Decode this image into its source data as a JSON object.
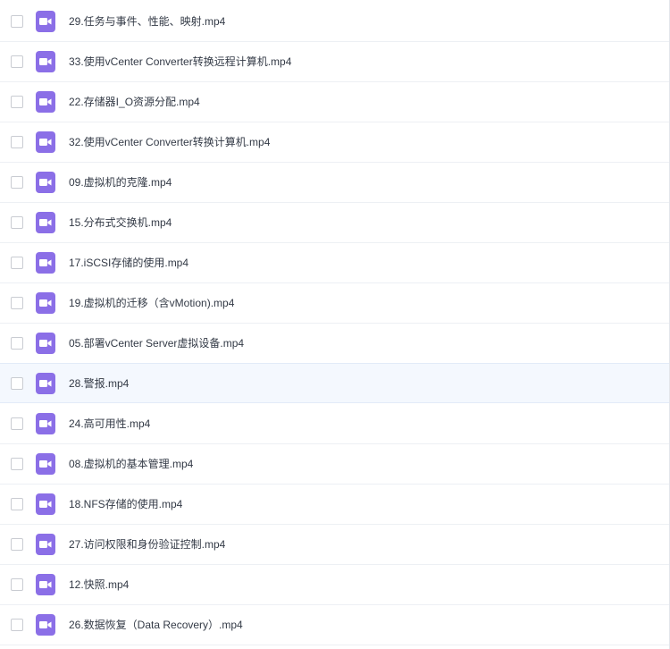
{
  "files": [
    {
      "name": "29.任务与事件、性能、映射.mp4",
      "icon": "video-file-icon"
    },
    {
      "name": "33.使用vCenter Converter转换远程计算机.mp4",
      "icon": "video-file-icon"
    },
    {
      "name": "22.存储器I_O资源分配.mp4",
      "icon": "video-file-icon"
    },
    {
      "name": "32.使用vCenter Converter转换计算机.mp4",
      "icon": "video-file-icon"
    },
    {
      "name": "09.虚拟机的克隆.mp4",
      "icon": "video-file-icon"
    },
    {
      "name": "15.分布式交换机.mp4",
      "icon": "video-file-icon"
    },
    {
      "name": "17.iSCSI存储的使用.mp4",
      "icon": "video-file-icon"
    },
    {
      "name": "19.虚拟机的迁移（含vMotion).mp4",
      "icon": "video-file-icon"
    },
    {
      "name": "05.部署vCenter Server虚拟设备.mp4",
      "icon": "video-file-icon"
    },
    {
      "name": "28.警报.mp4",
      "icon": "video-file-icon",
      "hovered": true
    },
    {
      "name": "24.高可用性.mp4",
      "icon": "video-file-icon"
    },
    {
      "name": "08.虚拟机的基本管理.mp4",
      "icon": "video-file-icon"
    },
    {
      "name": "18.NFS存储的使用.mp4",
      "icon": "video-file-icon"
    },
    {
      "name": "27.访问权限和身份验证控制.mp4",
      "icon": "video-file-icon"
    },
    {
      "name": "12.快照.mp4",
      "icon": "video-file-icon"
    },
    {
      "name": "26.数据恢复（Data Recovery）.mp4",
      "icon": "video-file-icon"
    }
  ],
  "colors": {
    "icon_bg": "#8b6fe7",
    "row_hover_bg": "#f4f8fe",
    "text": "#333a46",
    "divider": "#edf0f4"
  }
}
